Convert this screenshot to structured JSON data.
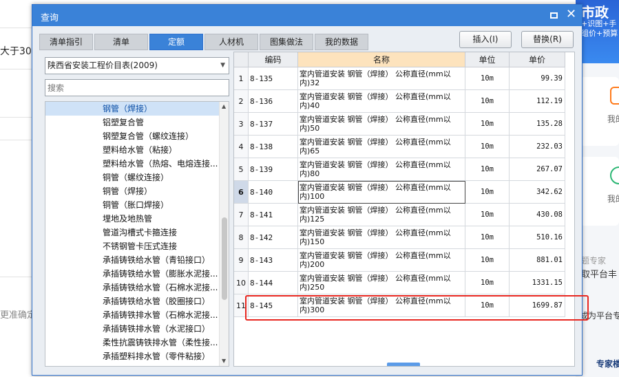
{
  "dialog": {
    "title": "查询",
    "maximize_icon": "maximize-icon",
    "close_glyph": "✕",
    "tabs": [
      "清单指引",
      "清单",
      "定额",
      "人材机",
      "图集做法",
      "我的数据"
    ],
    "active_tab": 2,
    "insert_button": "插入(I)",
    "replace_button": "替换(R)"
  },
  "left": {
    "catalog_select": "陕西省安装工程价目表(2009)",
    "search_placeholder": "搜索",
    "tree_items": [
      "钢管（焊接）",
      "铝塑复合管",
      "钢塑复合管（螺纹连接）",
      "塑料给水管（粘接）",
      "塑料给水管（热熔、电熔连接...",
      "铜管（螺纹连接）",
      "铜管（焊接）",
      "铜管（胀口焊接）",
      "埋地及地热管",
      "管道沟槽式卡箍连接",
      "不锈钢管卡压式连接",
      "承插铸铁给水管（青铅接口）",
      "承插铸铁给水管（膨胀水泥接...",
      "承插铸铁给水管（石棉水泥接...",
      "承插铸铁给水管（胶圈接口）",
      "承插铸铁排水管（石棉水泥接...",
      "承插铸铁排水管（水泥接口）",
      "柔性抗震铸铁排水管（柔性接...",
      "承插塑料排水管（零件粘接）",
      "..."
    ],
    "selected_index": 0
  },
  "grid": {
    "headers": {
      "code": "编码",
      "name": "名称",
      "unit": "单位",
      "price": "单价"
    },
    "rows": [
      {
        "idx": "1",
        "code": "8-135",
        "name1": "室内管道安装 钢管（焊接） 公称直径(mm以",
        "name2": "内)32",
        "unit": "10m",
        "price": "99.39"
      },
      {
        "idx": "2",
        "code": "8-136",
        "name1": "室内管道安装 钢管（焊接） 公称直径(mm以",
        "name2": "内)40",
        "unit": "10m",
        "price": "112.19"
      },
      {
        "idx": "3",
        "code": "8-137",
        "name1": "室内管道安装 钢管（焊接） 公称直径(mm以",
        "name2": "内)50",
        "unit": "10m",
        "price": "135.28"
      },
      {
        "idx": "4",
        "code": "8-138",
        "name1": "室内管道安装 钢管（焊接） 公称直径(mm以",
        "name2": "内)65",
        "unit": "10m",
        "price": "232.03"
      },
      {
        "idx": "5",
        "code": "8-139",
        "name1": "室内管道安装 钢管（焊接） 公称直径(mm以",
        "name2": "内)80",
        "unit": "10m",
        "price": "267.07"
      },
      {
        "idx": "6",
        "code": "8-140",
        "name1": "室内管道安装 钢管（焊接） 公称直径(mm以",
        "name2": "内)100",
        "unit": "10m",
        "price": "342.62"
      },
      {
        "idx": "7",
        "code": "8-141",
        "name1": "室内管道安装 钢管（焊接） 公称直径(mm以",
        "name2": "内)125",
        "unit": "10m",
        "price": "430.08"
      },
      {
        "idx": "8",
        "code": "8-142",
        "name1": "室内管道安装 钢管（焊接） 公称直径(mm以",
        "name2": "内)150",
        "unit": "10m",
        "price": "510.16"
      },
      {
        "idx": "9",
        "code": "8-143",
        "name1": "室内管道安装 钢管（焊接） 公称直径(mm以",
        "name2": "内)200",
        "unit": "10m",
        "price": "881.01"
      },
      {
        "idx": "10",
        "code": "8-144",
        "name1": "室内管道安装 钢管（焊接） 公称直径(mm以",
        "name2": "内)250",
        "unit": "10m",
        "price": "1331.15"
      },
      {
        "idx": "11",
        "code": "8-145",
        "name1": "室内管道安装 钢管（焊接） 公称直径(mm以",
        "name2": "内)300",
        "unit": "10m",
        "price": "1699.87"
      }
    ],
    "current_row": 5,
    "highlighted_row": 10,
    "highlight_color": "#e8261f"
  },
  "background": {
    "left_text_a": "大于30",
    "left_text_b": "更准确定",
    "right_banner_1": "市政",
    "right_banner_2": "+识图+手",
    "right_banner_3": "组价+预算",
    "right_card_1": "我的",
    "right_card_2": "我的",
    "right_text_1": "题专家",
    "right_text_2": "取平台丰",
    "right_text_3": "成为平台专",
    "right_text_4": "专家楼"
  },
  "colors": {
    "titlebar": "#3a82d8",
    "name_header": "#fde3bd",
    "tree_selected": "#cfe2f7"
  }
}
